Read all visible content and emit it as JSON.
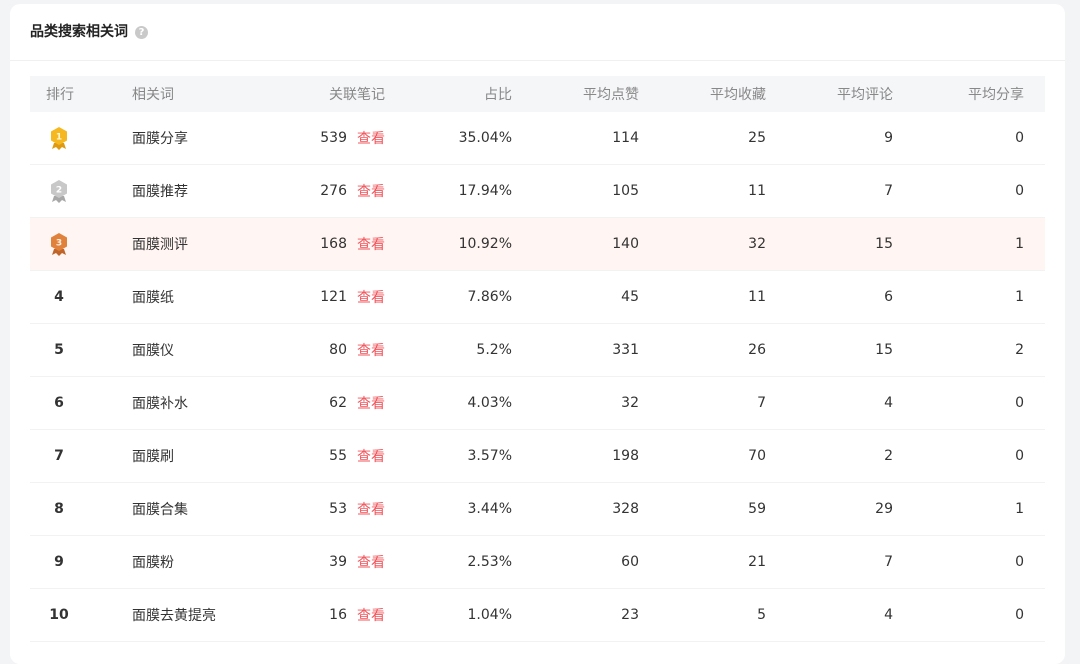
{
  "card": {
    "title": "品类搜索相关词",
    "help_icon": "question-circle-icon"
  },
  "table": {
    "headers": {
      "rank": "排行",
      "word": "相关词",
      "notes": "关联笔记",
      "ratio": "占比",
      "likes": "平均点赞",
      "collect": "平均收藏",
      "comment": "平均评论",
      "share": "平均分享"
    },
    "view_label": "查看",
    "rows": [
      {
        "rank": "1",
        "medal": "gold",
        "word": "面膜分享",
        "notes": "539",
        "ratio": "35.04%",
        "likes": "114",
        "collect": "25",
        "comment": "9",
        "share": "0"
      },
      {
        "rank": "2",
        "medal": "silver",
        "word": "面膜推荐",
        "notes": "276",
        "ratio": "17.94%",
        "likes": "105",
        "collect": "11",
        "comment": "7",
        "share": "0"
      },
      {
        "rank": "3",
        "medal": "bronze",
        "word": "面膜测评",
        "notes": "168",
        "ratio": "10.92%",
        "likes": "140",
        "collect": "32",
        "comment": "15",
        "share": "1"
      },
      {
        "rank": "4",
        "word": "面膜纸",
        "notes": "121",
        "ratio": "7.86%",
        "likes": "45",
        "collect": "11",
        "comment": "6",
        "share": "1"
      },
      {
        "rank": "5",
        "word": "面膜仪",
        "notes": "80",
        "ratio": "5.2%",
        "likes": "331",
        "collect": "26",
        "comment": "15",
        "share": "2"
      },
      {
        "rank": "6",
        "word": "面膜补水",
        "notes": "62",
        "ratio": "4.03%",
        "likes": "32",
        "collect": "7",
        "comment": "4",
        "share": "0"
      },
      {
        "rank": "7",
        "word": "面膜刷",
        "notes": "55",
        "ratio": "3.57%",
        "likes": "198",
        "collect": "70",
        "comment": "2",
        "share": "0"
      },
      {
        "rank": "8",
        "word": "面膜合集",
        "notes": "53",
        "ratio": "3.44%",
        "likes": "328",
        "collect": "59",
        "comment": "29",
        "share": "1"
      },
      {
        "rank": "9",
        "word": "面膜粉",
        "notes": "39",
        "ratio": "2.53%",
        "likes": "60",
        "collect": "21",
        "comment": "7",
        "share": "0"
      },
      {
        "rank": "10",
        "word": "面膜去黄提亮",
        "notes": "16",
        "ratio": "1.04%",
        "likes": "23",
        "collect": "5",
        "comment": "4",
        "share": "0"
      }
    ]
  },
  "colors": {
    "accent_link": "#f0545a",
    "highlight_row": "#fff5f3",
    "gold": "#f5b820",
    "silver": "#c8c8c8",
    "bronze": "#e0823c"
  }
}
